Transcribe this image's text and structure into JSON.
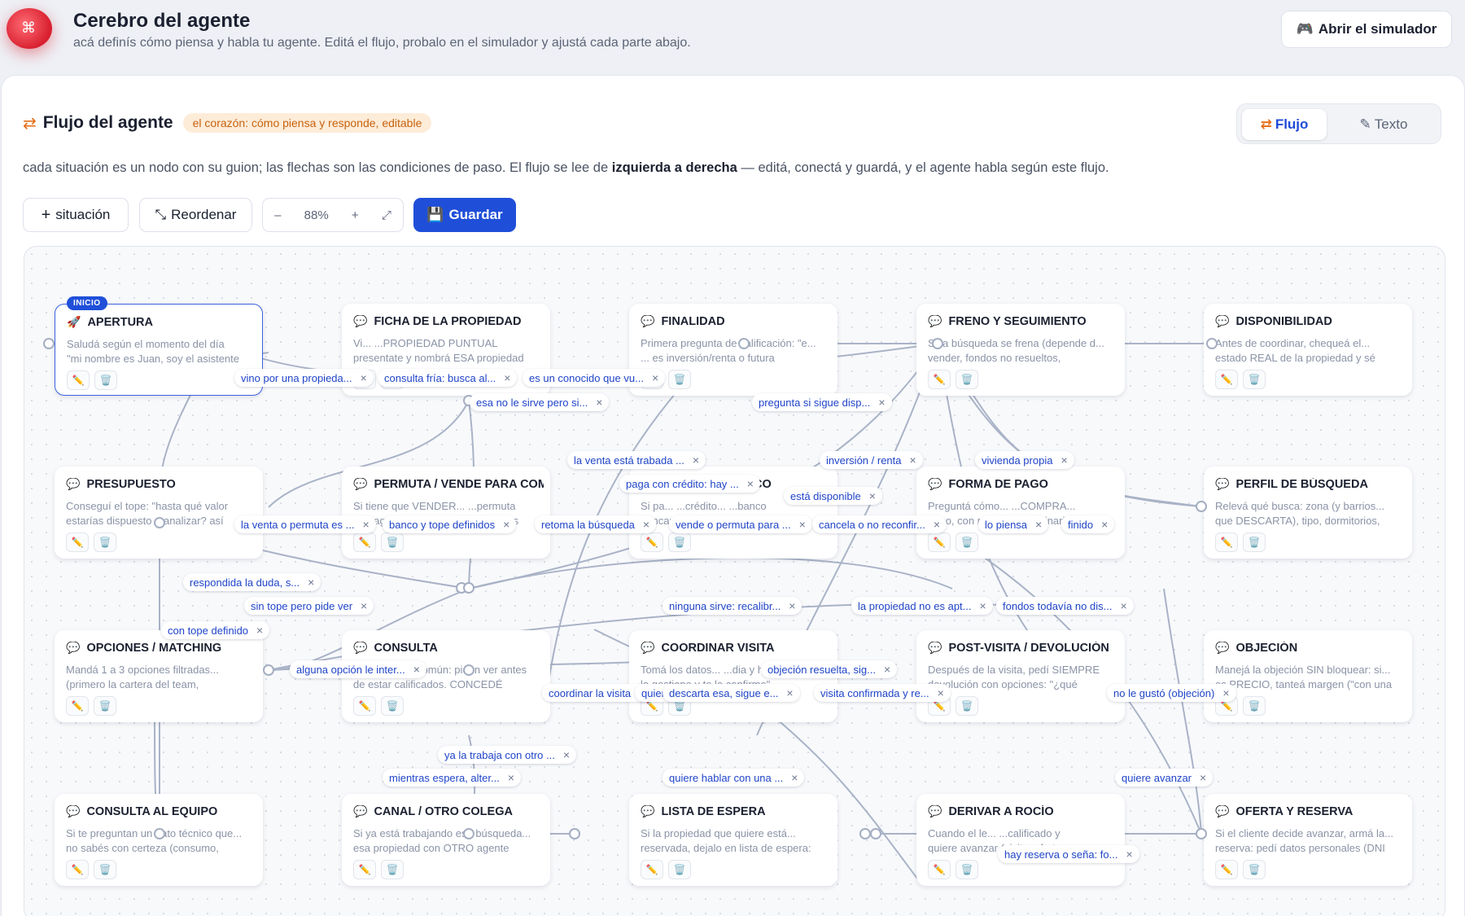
{
  "header": {
    "title": "Cerebro del agente",
    "subtitle": "acá definís cómo piensa y habla tu agente. Editá el flujo, probalo en el simulador y ajustá cada parte abajo.",
    "simulator_button": "Abrir el simulador",
    "simulator_icon": "gamepad-icon"
  },
  "panel": {
    "title": "Flujo del agente",
    "badge": "el corazón: cómo piensa y responde, editable",
    "description_pre": "cada situación es un nodo con su guion; las flechas son las condiciones de paso. El flujo se lee de ",
    "description_bold": "izquierda a derecha",
    "description_post": " — editá, conectá y guardá, y el agente habla según este flujo.",
    "tabs": [
      {
        "label": "Flujo",
        "icon": "shuffle-icon",
        "active": true
      },
      {
        "label": "Texto",
        "icon": "memo-icon",
        "active": false
      }
    ]
  },
  "toolbar": {
    "add_label": "situación",
    "reorder_label": "Reordenar",
    "zoom_minus": "–",
    "zoom_value": "88%",
    "zoom_plus": "+",
    "save_label": "Guardar"
  },
  "start_badge": "INICIO",
  "nodes": [
    {
      "title": "APERTURA",
      "line1": "Saludá según el momento del día",
      "line2": "\"mi nombre es Juan, soy el asistente"
    },
    {
      "title": "FICHA DE LA PROPIEDAD",
      "line1": "Vi... ...PROPIEDAD PUNTUAL",
      "line2": "presentate y nombrá ESA propiedad"
    },
    {
      "title": "FINALIDAD",
      "line1": "Primera pregunta de calificación: \"e...",
      "line2": "... es inversión/renta o futura"
    },
    {
      "title": "FRENO Y SEGUIMIENTO",
      "line1": "Si la búsqueda se frena (depende d...",
      "line2": "vender, fondos no resueltos,"
    },
    {
      "title": "DISPONIBILIDAD",
      "line1": "Antes de coordinar, chequeá el...",
      "line2": "estado REAL de la propiedad y sé"
    },
    {
      "title": "PRESUPUESTO",
      "line1": "Conseguí el tope: \"hasta qué valor",
      "line2": "estarías dispuesto a analizar? así"
    },
    {
      "title": "PERMUTA / VENDE PARA COMPRAR",
      "line1": "Si tiene que VENDER... ...permuta",
      "line2": "de pago, sondeá: ¿con quién estás"
    },
    {
      "title": "CRÉDITO Y BANCO",
      "line1": "Si pa... ...crédito... ...banco",
      "line2": "bancario gestionado? ¿y ya lo tiene"
    },
    {
      "title": "FORMA DE PAGO",
      "line1": "Preguntá cómo... ...COMPRA...",
      "line2": "pago, con mano (no es binario). ¿Cu"
    },
    {
      "title": "PERFIL DE BÚSQUEDA",
      "line1": "Relevá qué busca: zona (y barrios...",
      "line2": "que DESCARTA), tipo, dormitorios,"
    },
    {
      "title": "OPCIONES / MATCHING",
      "line1": "Mandá 1 a 3 opciones filtradas...",
      "line2": "(primero la cartera del team,"
    },
    {
      "title": "CONSULTA",
      "line1": "El caso MÁS común: piden ver antes",
      "line2": "de estar calificados. CONCEDÉ"
    },
    {
      "title": "COORDINAR VISITA",
      "line1": "Tomá los datos... ...dia y horario",
      "line2": "lo gestiono y te lo confirmo\""
    },
    {
      "title": "POST-VISITA / DEVOLUCIÓN",
      "line1": "Después de la visita, pedí SIEMPRE",
      "line2": "devolución con opciones: \"¿qué"
    },
    {
      "title": "OBJECIÓN",
      "line1": "Manejá la objeción SIN bloquear: si...",
      "line2": "es PRECIO, tanteá margen (\"con una"
    },
    {
      "title": "CONSULTA AL EQUIPO",
      "line1": "Si te preguntan un dato técnico que...",
      "line2": "no sabés con certeza (consumo,"
    },
    {
      "title": "CANAL / OTRO COLEGA",
      "line1": "Si ya está trabajando esa búsqueda...",
      "line2": "esa propiedad con OTRO agente"
    },
    {
      "title": "LISTA DE ESPERA",
      "line1": "Si la propiedad que quiere está...",
      "line2": "reservada, dejalo en lista de espera:"
    },
    {
      "title": "DERIVAR A ROCÍO",
      "line1": "Cuando el le... ...calificado y",
      "line2": "quiere avanzar (visita, oferta o"
    },
    {
      "title": "OFERTA Y RESERVA",
      "line1": "Si el cliente decide avanzar, armá la...",
      "line2": "reserva: pedí datos personales (DNI"
    }
  ],
  "edge_labels": [
    "vino por una propieda...",
    "consulta fría: busca al...",
    "es un conocido que vu...",
    "esa no le sirve pero si...",
    "pregunta si sigue disp...",
    "la venta está trabada ...",
    "paga con crédito: hay ...",
    "inversión / renta",
    "vivienda propia",
    "está disponible",
    "la venta o permuta es ...",
    "banco y tope definidos",
    "retoma la búsqueda",
    "vende o permuta para ...",
    "cancela o no reconfir...",
    "lo piensa",
    "finido",
    "respondida la duda, s...",
    "sin tope pero pide ver",
    "con tope definido",
    "ninguna sirve: recalibr...",
    "la propiedad no es apt...",
    "fondos todavía no dis...",
    "alguna opción le inter...",
    "objeción resuelta, sig...",
    "coordinar la visita",
    "quier",
    "descarta esa, sigue e...",
    "visita confirmada y re...",
    "no le gustó (objeción)",
    "ya la trabaja con otro ...",
    "mientras espera, alter...",
    "quiere hablar con una ...",
    "quiere avanzar",
    "hay reserva o seña: fo..."
  ]
}
